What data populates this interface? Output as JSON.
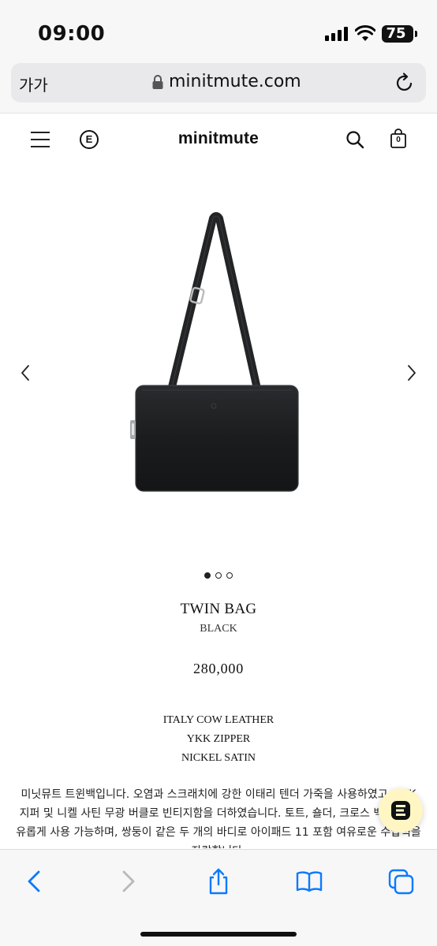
{
  "status_bar": {
    "time": "09:00",
    "battery": "75"
  },
  "browser": {
    "text_size_label": "가가",
    "url": "minitmute.com"
  },
  "site": {
    "logo": "minitmute",
    "brand_badge": "E",
    "cart_count": "0"
  },
  "product": {
    "name": "TWIN BAG",
    "color": "BLACK",
    "price": "280,000",
    "specs": [
      "ITALY COW LEATHER",
      "YKK ZIPPER",
      "NICKEL SATIN"
    ],
    "description": "미닛뮤트 트윈백입니다. 오염과 스크래치에 강한 이태리 텐더 가죽을 사용하였고, YKK 지퍼 및 니켈 사틴 무광 버클로 빈티지함을 더하였습니다. 토트, 숄더, 크로스 백으로 자유롭게 사용 가능하며, 쌍둥이 같은 두 개의 바디로 아이패드 11 포함 여유로운 수납력을 자랑합니다."
  },
  "carousel": {
    "total": 3,
    "active_index": 0
  },
  "icons": {
    "status": [
      "signal-icon",
      "wifi-icon",
      "battery-icon"
    ],
    "header": [
      "menu-icon",
      "search-icon",
      "cart-icon"
    ],
    "toolbar": [
      "back-icon",
      "forward-icon",
      "share-icon",
      "bookmarks-icon",
      "tabs-icon"
    ]
  },
  "colors": {
    "accent_ios": "#0a7aff",
    "chat_bg": "#fff6c4",
    "bag": "#1c1d1f"
  }
}
